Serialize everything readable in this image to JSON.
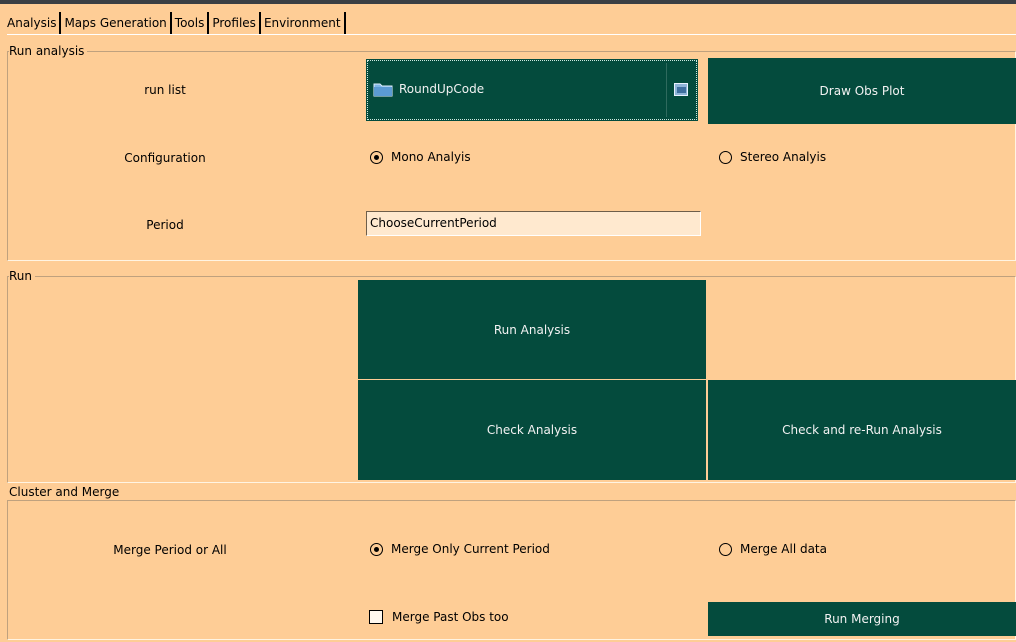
{
  "tabs": [
    "Analysis",
    "Maps Generation",
    "Tools",
    "Profiles",
    "Environment"
  ],
  "run_analysis": {
    "title": "Run analysis",
    "run_list_label": "run list",
    "run_list_value": "RoundUpCode",
    "draw_obs_plot": "Draw Obs Plot",
    "configuration_label": "Configuration",
    "mono_label": "Mono Analyis",
    "stereo_label": "Stereo Analyis",
    "mono_selected": true,
    "period_label": "Period",
    "period_value": "ChooseCurrentPeriod"
  },
  "run": {
    "title": "Run",
    "run_analysis": "Run Analysis",
    "check_analysis": "Check Analysis",
    "check_rerun": "Check and re-Run Analysis"
  },
  "cluster_merge": {
    "title": "Cluster and Merge",
    "merge_label": "Merge Period or All",
    "merge_current": "Merge Only Current Period",
    "merge_all": "Merge All data",
    "merge_current_selected": true,
    "merge_past": "Merge Past Obs too",
    "merge_past_checked": false,
    "run_merging": "Run Merging"
  },
  "colors": {
    "background": "#fecd96",
    "button": "#044b3d",
    "button_text": "#f2f2f2"
  },
  "icons": [
    "folder-icon",
    "folder-open-icon",
    "radio-icon",
    "checkbox-icon"
  ]
}
